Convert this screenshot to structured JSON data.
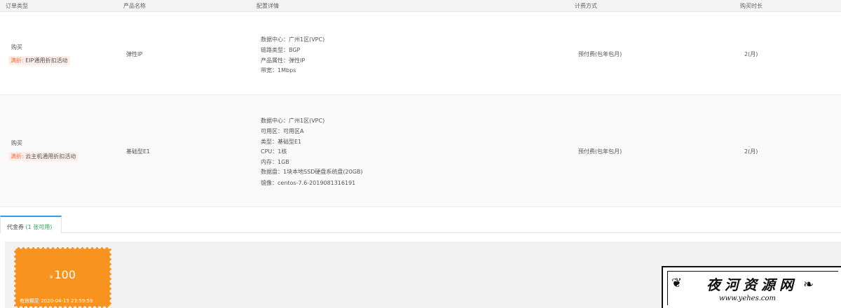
{
  "table": {
    "headers": {
      "order_type": "订单类型",
      "product_name": "产品名称",
      "config_detail": "配置详情",
      "billing_method": "计费方式",
      "duration": "购买时长"
    },
    "rows": [
      {
        "order_type": "购买",
        "promo_tag": "满折:",
        "promo_text": "EIP通用折扣活动",
        "product_name": "弹性IP",
        "details": [
          "数据中心：广州1区(VPC)",
          "链路类型：BGP",
          "产品属性：弹性IP",
          "带宽：1Mbps"
        ],
        "billing": "预付费(包年包月)",
        "duration": "2(月)"
      },
      {
        "order_type": "购买",
        "promo_tag": "满折:",
        "promo_text": "云主机通用折扣活动",
        "product_name": "基础型E1",
        "details": [
          "数据中心：广州1区(VPC)",
          "可用区：可用区A",
          "类型：基础型E1",
          "CPU：1核",
          "内存：1GB",
          "数据盘：1块本地SSD硬盘系统盘(20GB)",
          "镜像：centos-7.6-2019081316191"
        ],
        "billing": "预付费(包年包月)",
        "duration": "2(月)"
      }
    ]
  },
  "voucher_tab": {
    "label": "代金券",
    "count": "(1 张可用)"
  },
  "coupon": {
    "currency": "¥",
    "amount": "100",
    "valid_until": "有效期至 2020-04-15 23:59:59"
  },
  "watermark": {
    "title": "夜河资源网",
    "url": "www.yehes.com"
  },
  "colors": {
    "accent_tab": "#2aa0e8",
    "promo_tag": "#f36b3b",
    "coupon_bg": "#f7931e",
    "available_count": "#27a35c"
  }
}
